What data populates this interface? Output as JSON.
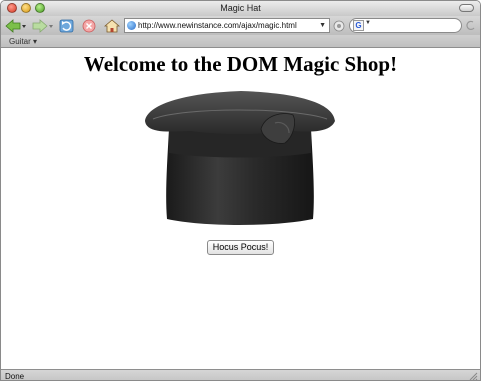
{
  "window": {
    "title": "Magic Hat"
  },
  "toolbar": {
    "url": "http://www.newinstance.com/ajax/magic.html",
    "search_engine_letter": "G"
  },
  "bookmarks": {
    "items": [
      {
        "label": "Guitar ▾"
      }
    ]
  },
  "page": {
    "heading": "Welcome to the DOM Magic Shop!",
    "button_label": "Hocus Pocus!"
  },
  "status": {
    "text": "Done"
  },
  "colors": {
    "accent_nav_green": "#6aa84f",
    "stop_red": "#e06666",
    "hat_dark": "#2b2b2b"
  }
}
